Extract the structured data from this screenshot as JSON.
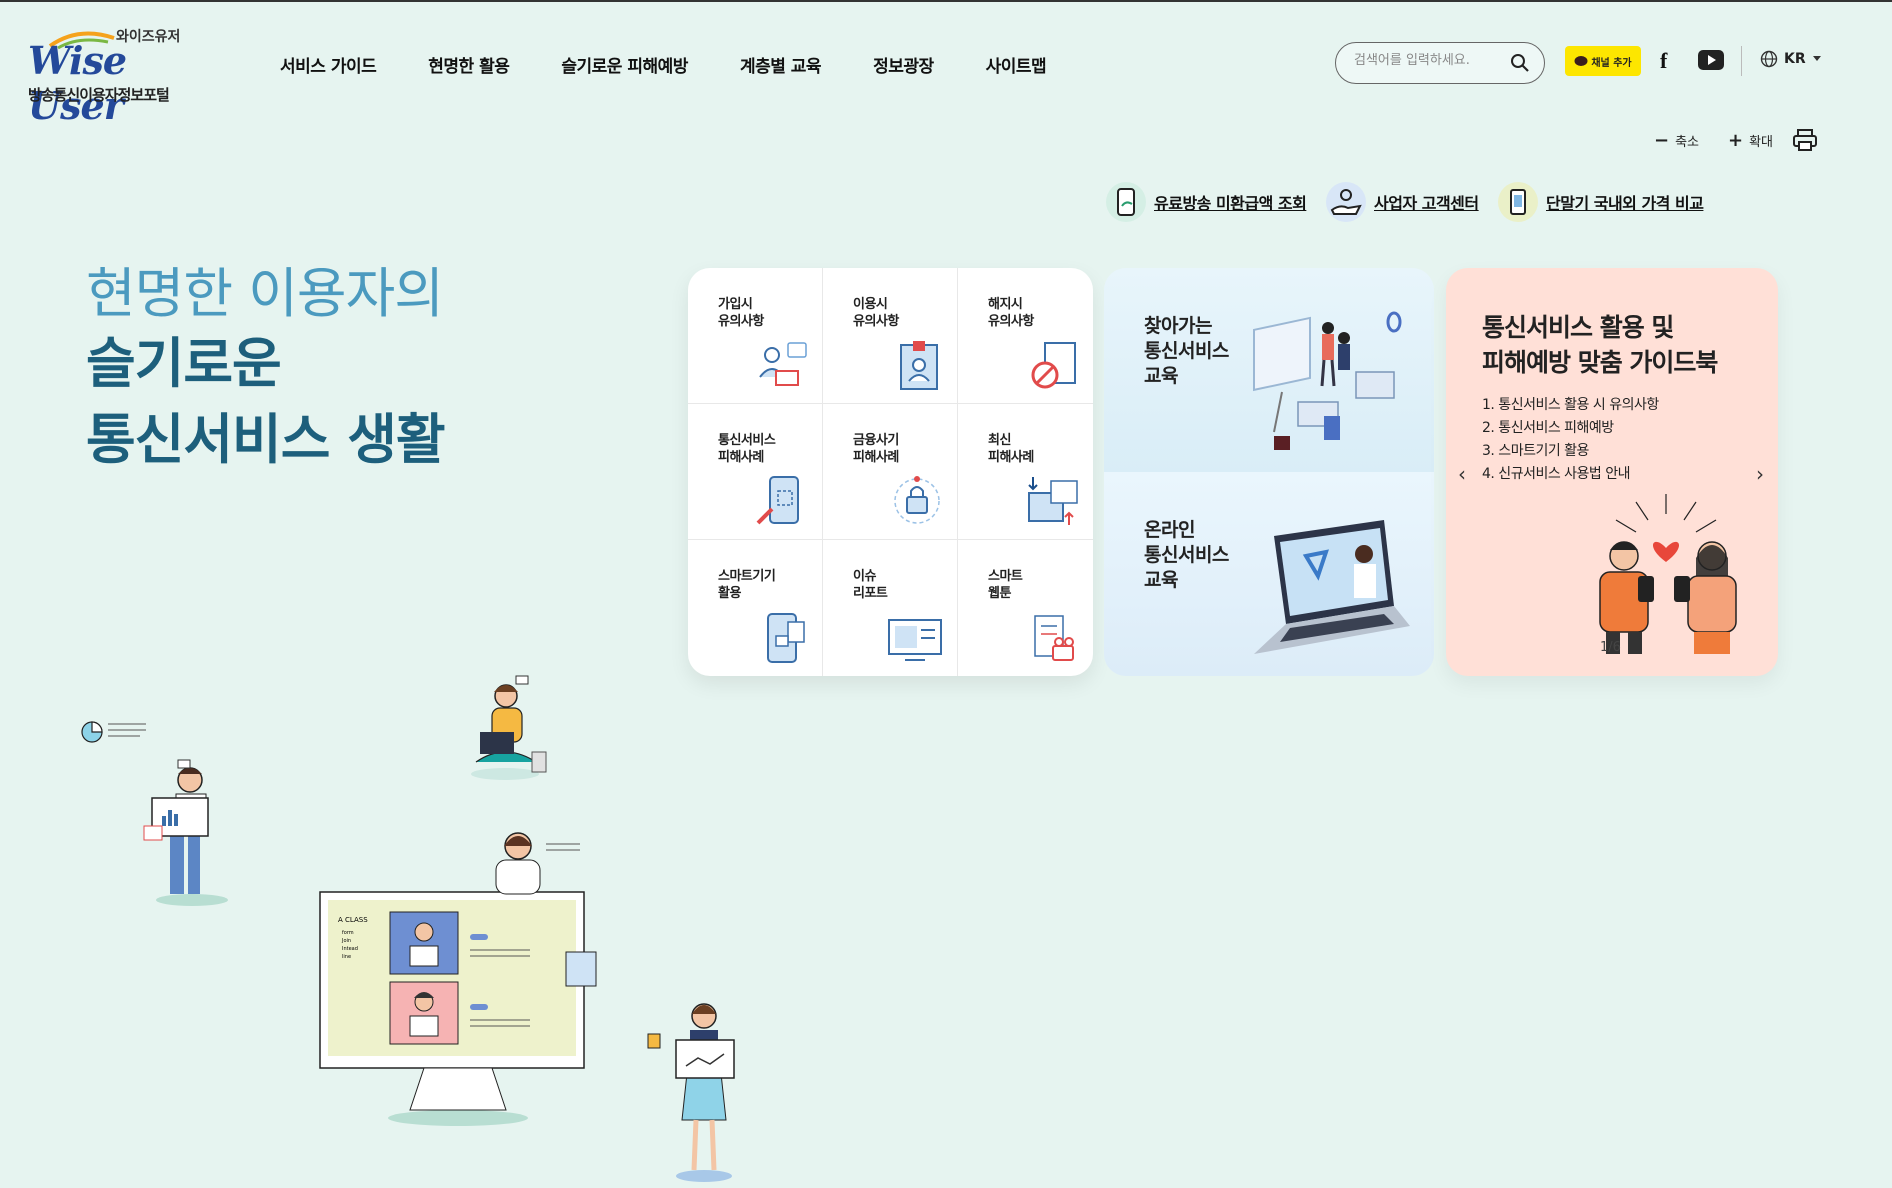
{
  "header": {
    "logo_korean": "와이즈유저",
    "logo_brand": "Wise User",
    "logo_subtitle": "방송통신이용자정보포털",
    "nav": [
      "서비스 가이드",
      "현명한 활용",
      "슬기로운 피해예방",
      "계층별 교육",
      "정보광장",
      "사이트맵"
    ],
    "search_placeholder": "검색어를 입력하세요.",
    "kakao_label": "채널 추가",
    "facebook_label": "f",
    "language": "KR"
  },
  "utility": {
    "zoom_out_symbol": "−",
    "zoom_out_label": "축소",
    "zoom_in_symbol": "+",
    "zoom_in_label": "확대"
  },
  "quick_links": [
    {
      "label": "유료방송 미환급액 조회",
      "icon": "phone-refund-icon"
    },
    {
      "label": "사업자 고객센터",
      "icon": "hand-service-icon"
    },
    {
      "label": "단말기 국내외 가격 비교",
      "icon": "device-price-icon"
    }
  ],
  "hero": {
    "line1": "현명한 이용자의",
    "line2": "슬기로운",
    "line3": "통신서비스 생활"
  },
  "menu_grid": [
    {
      "label": "가입시\n유의사항",
      "icon": "signup-icon"
    },
    {
      "label": "이용시\n유의사항",
      "icon": "usage-icon"
    },
    {
      "label": "해지시\n유의사항",
      "icon": "cancel-icon"
    },
    {
      "label": "통신서비스\n피해사례",
      "icon": "phone-damage-icon"
    },
    {
      "label": "금융사기\n피해사례",
      "icon": "lock-fraud-icon"
    },
    {
      "label": "최신\n피해사례",
      "icon": "latest-case-icon"
    },
    {
      "label": "스마트기기\n활용",
      "icon": "smart-device-icon"
    },
    {
      "label": "이슈\n리포트",
      "icon": "report-icon"
    },
    {
      "label": "스마트\n웹툰",
      "icon": "webtoon-icon"
    }
  ],
  "education": [
    {
      "label": "찾아가는\n통신서비스\n교육"
    },
    {
      "label": "온라인\n통신서비스\n교육"
    }
  ],
  "guidebook": {
    "title": "통신서비스 활용 및\n피해예방 맞춤 가이드북",
    "items": [
      "1. 통신서비스 활용 시 유의사항",
      "2. 통신서비스 피해예방",
      "3. 스마트기기 활용",
      "4. 신규서비스 사용법 안내"
    ],
    "prev": "‹",
    "next": "›",
    "pager": "1/6"
  },
  "illustration": {
    "screen_label": "A CLASS",
    "screen_items": [
      "form",
      "Join",
      "Intead",
      "line"
    ]
  },
  "colors": {
    "background": "#e6f4f0",
    "hero_light": "#4b9abf",
    "hero_dark": "#1d5f7c",
    "guide_bg": "#ffe0d7",
    "kakao": "#fde600"
  }
}
